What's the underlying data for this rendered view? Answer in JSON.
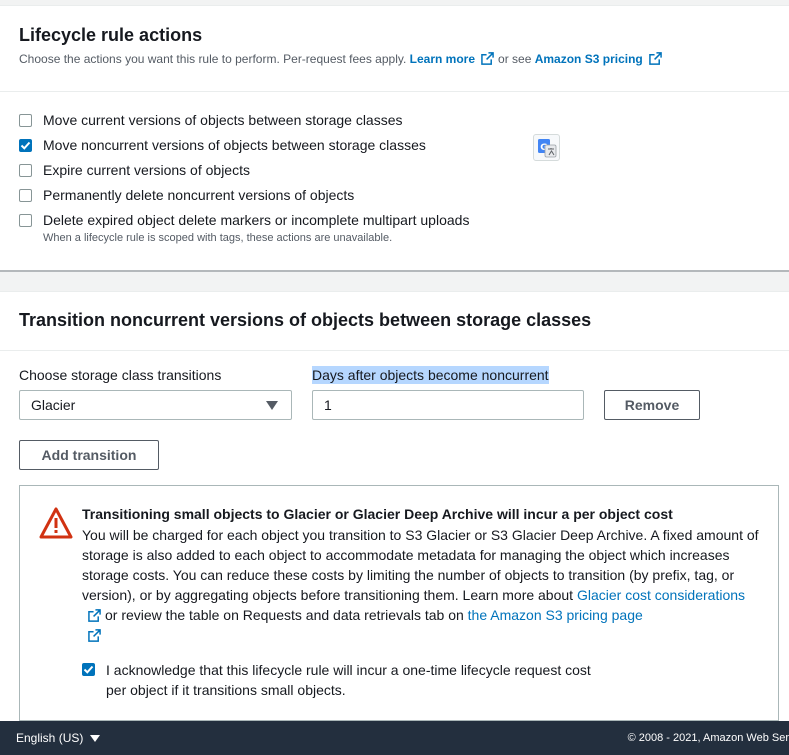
{
  "actions_panel": {
    "title": "Lifecycle rule actions",
    "description_prefix": "Choose the actions you want this rule to perform. Per-request fees apply.",
    "learn_more": "Learn more",
    "or_see": "or see",
    "pricing_link": "Amazon S3 pricing",
    "options": [
      {
        "label": "Move current versions of objects between storage classes",
        "checked": false
      },
      {
        "label": "Move noncurrent versions of objects between storage classes",
        "checked": true
      },
      {
        "label": "Expire current versions of objects",
        "checked": false
      },
      {
        "label": "Permanently delete noncurrent versions of objects",
        "checked": false
      },
      {
        "label": "Delete expired object delete markers or incomplete multipart uploads",
        "checked": false
      }
    ],
    "option_hint": "When a lifecycle rule is scoped with tags, these actions are unavailable."
  },
  "transition_panel": {
    "title": "Transition noncurrent versions of objects between storage classes",
    "storage_class_label": "Choose storage class transitions",
    "storage_class_value": "Glacier",
    "days_label": "Days after objects become noncurrent",
    "days_value": "1",
    "remove_button": "Remove",
    "add_transition_button": "Add transition"
  },
  "warning": {
    "title": "Transitioning small objects to Glacier or Glacier Deep Archive will incur a per object cost",
    "body_text": "You will be charged for each object you transition to S3 Glacier or S3 Glacier Deep Archive. A fixed amount of storage is also added to each object to accommodate metadata for managing the object which increases storage costs. You can reduce these costs by limiting the number of objects to transition (by prefix, tag, or version), or by aggregating objects before transitioning them. Learn more about",
    "glacier_link": "Glacier cost considerations",
    "middle_text": "or review the table on Requests and data retrievals tab on",
    "pricing_page_link": "the Amazon S3 pricing page",
    "acknowledge_label": "I acknowledge that this lifecycle rule will incur a one-time lifecycle request cost per object if it transitions small objects.",
    "acknowledge_checked": true
  },
  "footer": {
    "language": "English (US)",
    "copyright": "© 2008 - 2021, Amazon Web Ser"
  },
  "colors": {
    "accent": "#0073bb",
    "warning_red": "#d13212",
    "footer_bg": "#232f3e"
  }
}
